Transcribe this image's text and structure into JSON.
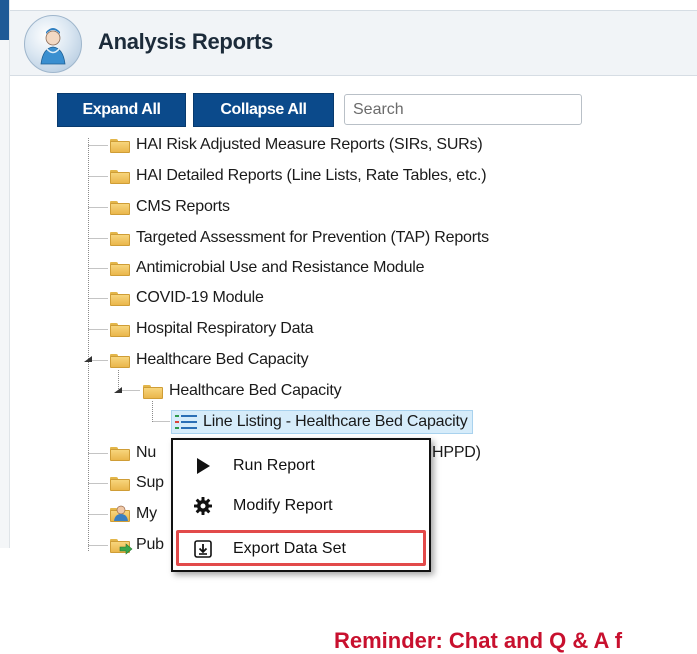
{
  "header": {
    "title": "Analysis Reports"
  },
  "toolbar": {
    "expand_label": "Expand All",
    "collapse_label": "Collapse All",
    "search_placeholder": "Search"
  },
  "tree": {
    "items": [
      {
        "label": "HAI Risk Adjusted Measure Reports (SIRs, SURs)"
      },
      {
        "label": "HAI Detailed Reports (Line Lists, Rate Tables, etc.)"
      },
      {
        "label": "CMS Reports"
      },
      {
        "label": "Targeted Assessment for Prevention (TAP) Reports"
      },
      {
        "label": "Antimicrobial Use and Resistance Module"
      },
      {
        "label": "COVID-19 Module"
      },
      {
        "label": "Hospital Respiratory Data"
      },
      {
        "label": "Healthcare Bed Capacity"
      },
      {
        "label": "Healthcare Bed Capacity"
      },
      {
        "label": "Line Listing - Healthcare Bed Capacity"
      },
      {
        "label": "Nu"
      },
      {
        "label": "HPPD)"
      },
      {
        "label": "Sup"
      },
      {
        "label": "My"
      },
      {
        "label": "Pub"
      }
    ]
  },
  "context_menu": {
    "items": [
      {
        "label": "Run Report",
        "icon": "play-icon"
      },
      {
        "label": "Modify Report",
        "icon": "gear-icon"
      },
      {
        "label": "Export Data Set",
        "icon": "export-icon"
      }
    ],
    "highlight_color": "#e24a4a"
  },
  "footer": {
    "reminder": "Reminder: Chat and Q & A f"
  },
  "colors": {
    "button_bg": "#0b4a8b",
    "selected_bg": "#d6ecfa",
    "reminder": "#c8102e"
  }
}
